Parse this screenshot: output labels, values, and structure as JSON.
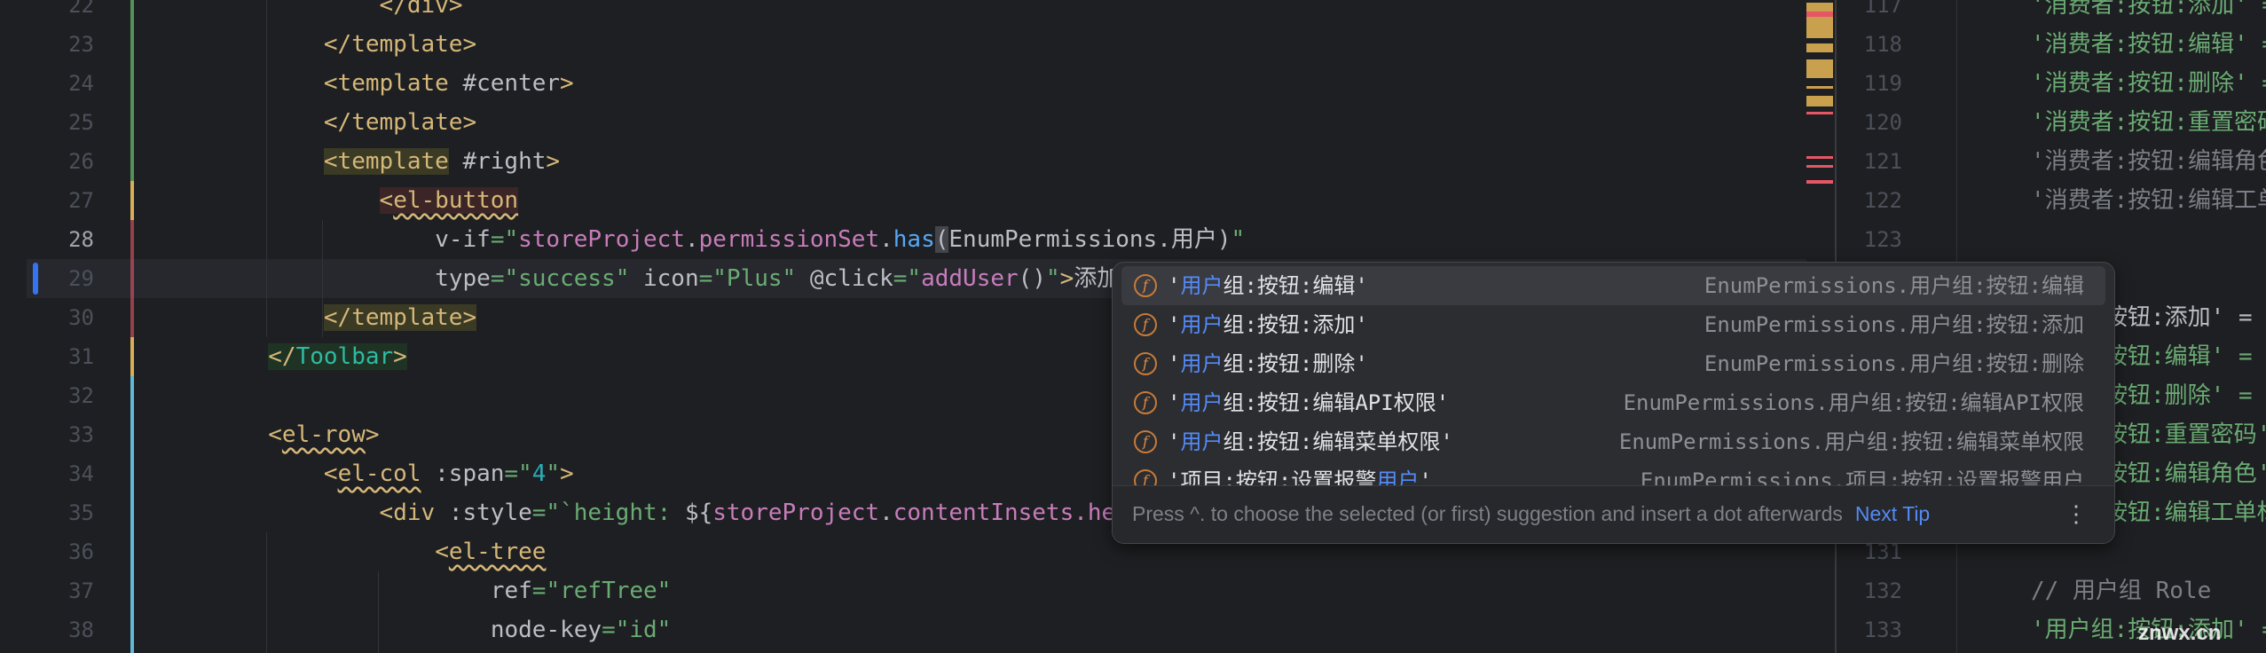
{
  "left_editor": {
    "current_line": 28,
    "lines": [
      {
        "n": "22",
        "indent": 16,
        "tokens": [
          {
            "t": "</",
            "c": "tag"
          },
          {
            "t": "div",
            "c": "tagname"
          },
          {
            "t": ">",
            "c": "tag"
          }
        ]
      },
      {
        "n": "23",
        "indent": 12,
        "tokens": [
          {
            "t": "</template>",
            "c": "tag"
          }
        ]
      },
      {
        "n": "24",
        "indent": 12,
        "tokens": [
          {
            "t": "<template ",
            "c": "tag"
          },
          {
            "t": "#center",
            "c": "attr"
          },
          {
            "t": ">",
            "c": "tag"
          }
        ]
      },
      {
        "n": "25",
        "indent": 12,
        "tokens": [
          {
            "t": "</template>",
            "c": "tag"
          }
        ]
      },
      {
        "n": "26",
        "indent": 12,
        "tokens": [
          {
            "t": "<template",
            "c": "tag hl-olive"
          },
          {
            "t": " #right",
            "c": "attr"
          },
          {
            "t": ">",
            "c": "tag"
          }
        ]
      },
      {
        "n": "27",
        "indent": 16,
        "tokens": [
          {
            "t": "<",
            "c": "tag hl-red"
          },
          {
            "t": "el-button",
            "c": "tag hl-red wavy"
          }
        ]
      },
      {
        "n": "28",
        "indent": 20,
        "tokens": [
          {
            "t": "v-if",
            "c": "attr"
          },
          {
            "t": "=\"",
            "c": "str"
          },
          {
            "t": "storeProject",
            "c": "expr"
          },
          {
            "t": ".",
            "c": "plain"
          },
          {
            "t": "permissionSet",
            "c": "expr"
          },
          {
            "t": ".",
            "c": "plain"
          },
          {
            "t": "has",
            "c": "fn"
          },
          {
            "t": "(",
            "c": "plain hl-brace"
          },
          {
            "t": "EnumPermissions.用户)",
            "c": "plain"
          },
          {
            "t": "\"",
            "c": "str"
          }
        ]
      },
      {
        "n": "29",
        "indent": 20,
        "tokens": [
          {
            "t": "type",
            "c": "attr"
          },
          {
            "t": "=\"success\" ",
            "c": "str"
          },
          {
            "t": "icon",
            "c": "attr"
          },
          {
            "t": "=\"Plus\" ",
            "c": "str"
          },
          {
            "t": "@click",
            "c": "attr"
          },
          {
            "t": "=\"",
            "c": "str"
          },
          {
            "t": "addUser",
            "c": "expr"
          },
          {
            "t": "()",
            "c": "plain"
          },
          {
            "t": "\"",
            "c": "str"
          },
          {
            "t": ">",
            "c": "tag"
          },
          {
            "t": "添加",
            "c": "plain"
          }
        ]
      },
      {
        "n": "30",
        "indent": 12,
        "tokens": [
          {
            "t": "</template>",
            "c": "tag hl-olive"
          }
        ]
      },
      {
        "n": "31",
        "indent": 8,
        "tokens": [
          {
            "t": "</",
            "c": "tag hl-green"
          },
          {
            "t": "Toolbar",
            "c": "comp hl-green"
          },
          {
            "t": ">",
            "c": "tag hl-green"
          }
        ]
      },
      {
        "n": "32",
        "indent": 0,
        "tokens": []
      },
      {
        "n": "33",
        "indent": 8,
        "tokens": [
          {
            "t": "<",
            "c": "tag"
          },
          {
            "t": "el-row",
            "c": "tag wavy"
          },
          {
            "t": ">",
            "c": "tag"
          }
        ]
      },
      {
        "n": "34",
        "indent": 12,
        "tokens": [
          {
            "t": "<",
            "c": "tag"
          },
          {
            "t": "el-col",
            "c": "tag wavy"
          },
          {
            "t": " :span",
            "c": "attr"
          },
          {
            "t": "=\"",
            "c": "str"
          },
          {
            "t": "4",
            "c": "num"
          },
          {
            "t": "\"",
            "c": "str"
          },
          {
            "t": ">",
            "c": "tag"
          }
        ]
      },
      {
        "n": "35",
        "indent": 16,
        "tokens": [
          {
            "t": "<div ",
            "c": "tag"
          },
          {
            "t": ":style",
            "c": "attr"
          },
          {
            "t": "=\"`height: ",
            "c": "str"
          },
          {
            "t": "${",
            "c": "plain"
          },
          {
            "t": "storeProject",
            "c": "expr"
          },
          {
            "t": ".",
            "c": "plain"
          },
          {
            "t": "contentInsets",
            "c": "expr"
          },
          {
            "t": ".he",
            "c": "expr"
          }
        ]
      },
      {
        "n": "36",
        "indent": 20,
        "tokens": [
          {
            "t": "<",
            "c": "tag"
          },
          {
            "t": "el-tree",
            "c": "tag wavy"
          }
        ]
      },
      {
        "n": "37",
        "indent": 24,
        "tokens": [
          {
            "t": "ref",
            "c": "attr"
          },
          {
            "t": "=\"refTree\"",
            "c": "str"
          }
        ]
      },
      {
        "n": "38",
        "indent": 24,
        "tokens": [
          {
            "t": "node-key",
            "c": "attr"
          },
          {
            "t": "=\"id\"",
            "c": "str"
          }
        ]
      }
    ]
  },
  "right_editor": {
    "lines": [
      {
        "n": "117",
        "text": "'消费者:按钮:添加' =",
        "c": "str"
      },
      {
        "n": "118",
        "text": "'消费者:按钮:编辑' =",
        "c": "str"
      },
      {
        "n": "119",
        "text": "'消费者:按钮:删除' =",
        "c": "str"
      },
      {
        "n": "120",
        "text": "'消费者:按钮:重置密码'",
        "c": "str"
      },
      {
        "n": "121",
        "text": "'消费者:按钮:编辑角色",
        "c": "cmt"
      },
      {
        "n": "122",
        "text": "'消费者:按钮:编辑工单",
        "c": "cmt"
      },
      {
        "n": "123",
        "text": "",
        "c": "plain"
      },
      {
        "n": "",
        "text": "",
        "c": "plain"
      },
      {
        "n": "",
        "frag": "按钮:添加' =",
        "c": "attr"
      },
      {
        "n": "",
        "frag": "按钮:编辑' =",
        "c": "str"
      },
      {
        "n": "",
        "frag": "按钮:删除' =",
        "c": "str"
      },
      {
        "n": "",
        "frag": "按钮:重置密码'",
        "c": "str"
      },
      {
        "n": "",
        "frag": "按钮:编辑角色'",
        "c": "str"
      },
      {
        "n": "",
        "frag": "按钮:编辑工单标",
        "c": "str"
      },
      {
        "n": "131",
        "text": "",
        "c": "plain"
      },
      {
        "n": "132",
        "text": "// 用户组 Role",
        "c": "cmt"
      },
      {
        "n": "133",
        "text": "'用户组:按钮:添加' =",
        "c": "str"
      }
    ]
  },
  "completion_popup": {
    "icon": "field-f-icon",
    "items": [
      {
        "pre": "'",
        "match": "用户",
        "post": "组:按钮:编辑'",
        "type": "EnumPermissions.用户组:按钮:编辑",
        "selected": true
      },
      {
        "pre": "'",
        "match": "用户",
        "post": "组:按钮:添加'",
        "type": "EnumPermissions.用户组:按钮:添加"
      },
      {
        "pre": "'",
        "match": "用户",
        "post": "组:按钮:删除'",
        "type": "EnumPermissions.用户组:按钮:删除"
      },
      {
        "pre": "'",
        "match": "用户",
        "post": "组:按钮:编辑API权限'",
        "type": "EnumPermissions.用户组:按钮:编辑API权限"
      },
      {
        "pre": "'",
        "match": "用户",
        "post": "组:按钮:编辑菜单权限'",
        "type": "EnumPermissions.用户组:按钮:编辑菜单权限"
      },
      {
        "pre": "'项目:按钮:设置报警",
        "match": "用户",
        "post": "'",
        "type": "EnumPermissions.项目:按钮:设置报警用户"
      }
    ],
    "footer_hint": "Press ^. to choose the selected (or first) suggestion and insert a dot afterwards",
    "next_tip": "Next Tip",
    "more": "⋮"
  },
  "watermark": "znwx.cn",
  "colors": {
    "background": "#1e1f22",
    "accent": "#548af7",
    "tag": "#d5b778",
    "string": "#6aab73"
  }
}
